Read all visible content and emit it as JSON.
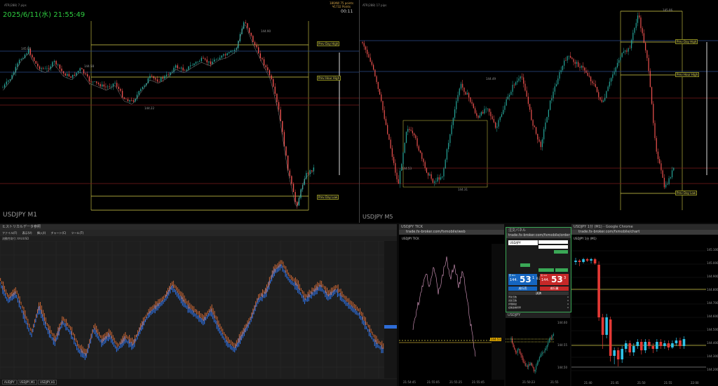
{
  "top_left": {
    "datetime": "2025/6/11(水) 21:55:49",
    "timer": "00:11",
    "symbol": "USDJPY M1",
    "indicator": "ATR(288) 7 pips",
    "corner_top": "180AW 75 points",
    "corner_bottom": "¥1732 Points",
    "levels": [
      "Prev Day High",
      "Prev Hour High",
      "Prev Day Low"
    ],
    "price_labels": [
      "145.06",
      "144.58",
      "144.22",
      "144.90"
    ]
  },
  "top_right": {
    "symbol": "USDJPY M5",
    "indicator": "ATR(288) 17 pips",
    "levels": [
      "Prev Day High",
      "Prev Hour High",
      "Prev Day Low"
    ],
    "price_labels": [
      "145.06",
      "144.49",
      "144.53",
      "144.31"
    ]
  },
  "bottom_left": {
    "title": "ヒストリカルデータ参照",
    "toolbar": [
      "ファイル(F)",
      "表示(V)",
      "挿入(I)",
      "チャート(C)",
      "ツール(T)"
    ],
    "chart_header": "流動性取引 XAUUSD",
    "tabs": [
      "AUDJPY",
      "USDJPY,M1",
      "USDJPY,H1"
    ]
  },
  "bottom_mid": {
    "window_title": "USDJPY TICK",
    "url": "trade.fx-broker.com/fxmobile/web",
    "symbol": "USDJPY TICK",
    "time_ticks": [
      "21:54:45",
      "21:55:05",
      "21:55:25",
      "21:55:45"
    ],
    "price": "144.53"
  },
  "panel": {
    "window_title": "注文パネル",
    "url": "trade.fx-broker.com/fxmobile/order",
    "pair": "USD/JPY",
    "sell_label": "売 Bid",
    "buy_label": "買 Ask",
    "sell_big": "53",
    "sell_prefix": "144.",
    "sell_sup": "1",
    "buy_big": "53",
    "buy_prefix": "144.",
    "buy_sup": "3",
    "spread": "0.2",
    "btn_sell": "成行売",
    "btn_buy": "成行買",
    "btn_close": "決済",
    "rows": [
      {
        "label": "売建玉数",
        "val": "0"
      },
      {
        "label": "買建玉数",
        "val": "0"
      },
      {
        "label": "評価損益",
        "val": "0"
      },
      {
        "label": "証拠金維持率",
        "val": "0"
      }
    ]
  },
  "mini": {
    "window_title": "USDJPY",
    "time_ticks": [
      "21:50:23",
      "21:55"
    ],
    "price_ticks": [
      "144.60",
      "144.55",
      "144.50"
    ]
  },
  "bottom_right": {
    "window_title": "USDJPY 1分 (M1) - Google Chrome",
    "url": "trade.fx-broker.com/fxmobile/chart",
    "symbol": "USDJPY 1分 (M1)",
    "price_ticks": [
      "145.100",
      "145.000",
      "144.900",
      "144.800",
      "144.700",
      "144.600",
      "144.500",
      "144.400",
      "144.300",
      "144.200"
    ],
    "time_ticks": [
      "21:40",
      "21:45",
      "21:50",
      "21:55",
      "22:00"
    ]
  },
  "colors": {
    "up": "#26a69a",
    "down": "#ef5350",
    "level": "#d8d04a",
    "cyan": "#2fc3e8",
    "red": "#e53935",
    "panel_green": "#3aa856",
    "blue_cell": "#1565c0"
  }
}
